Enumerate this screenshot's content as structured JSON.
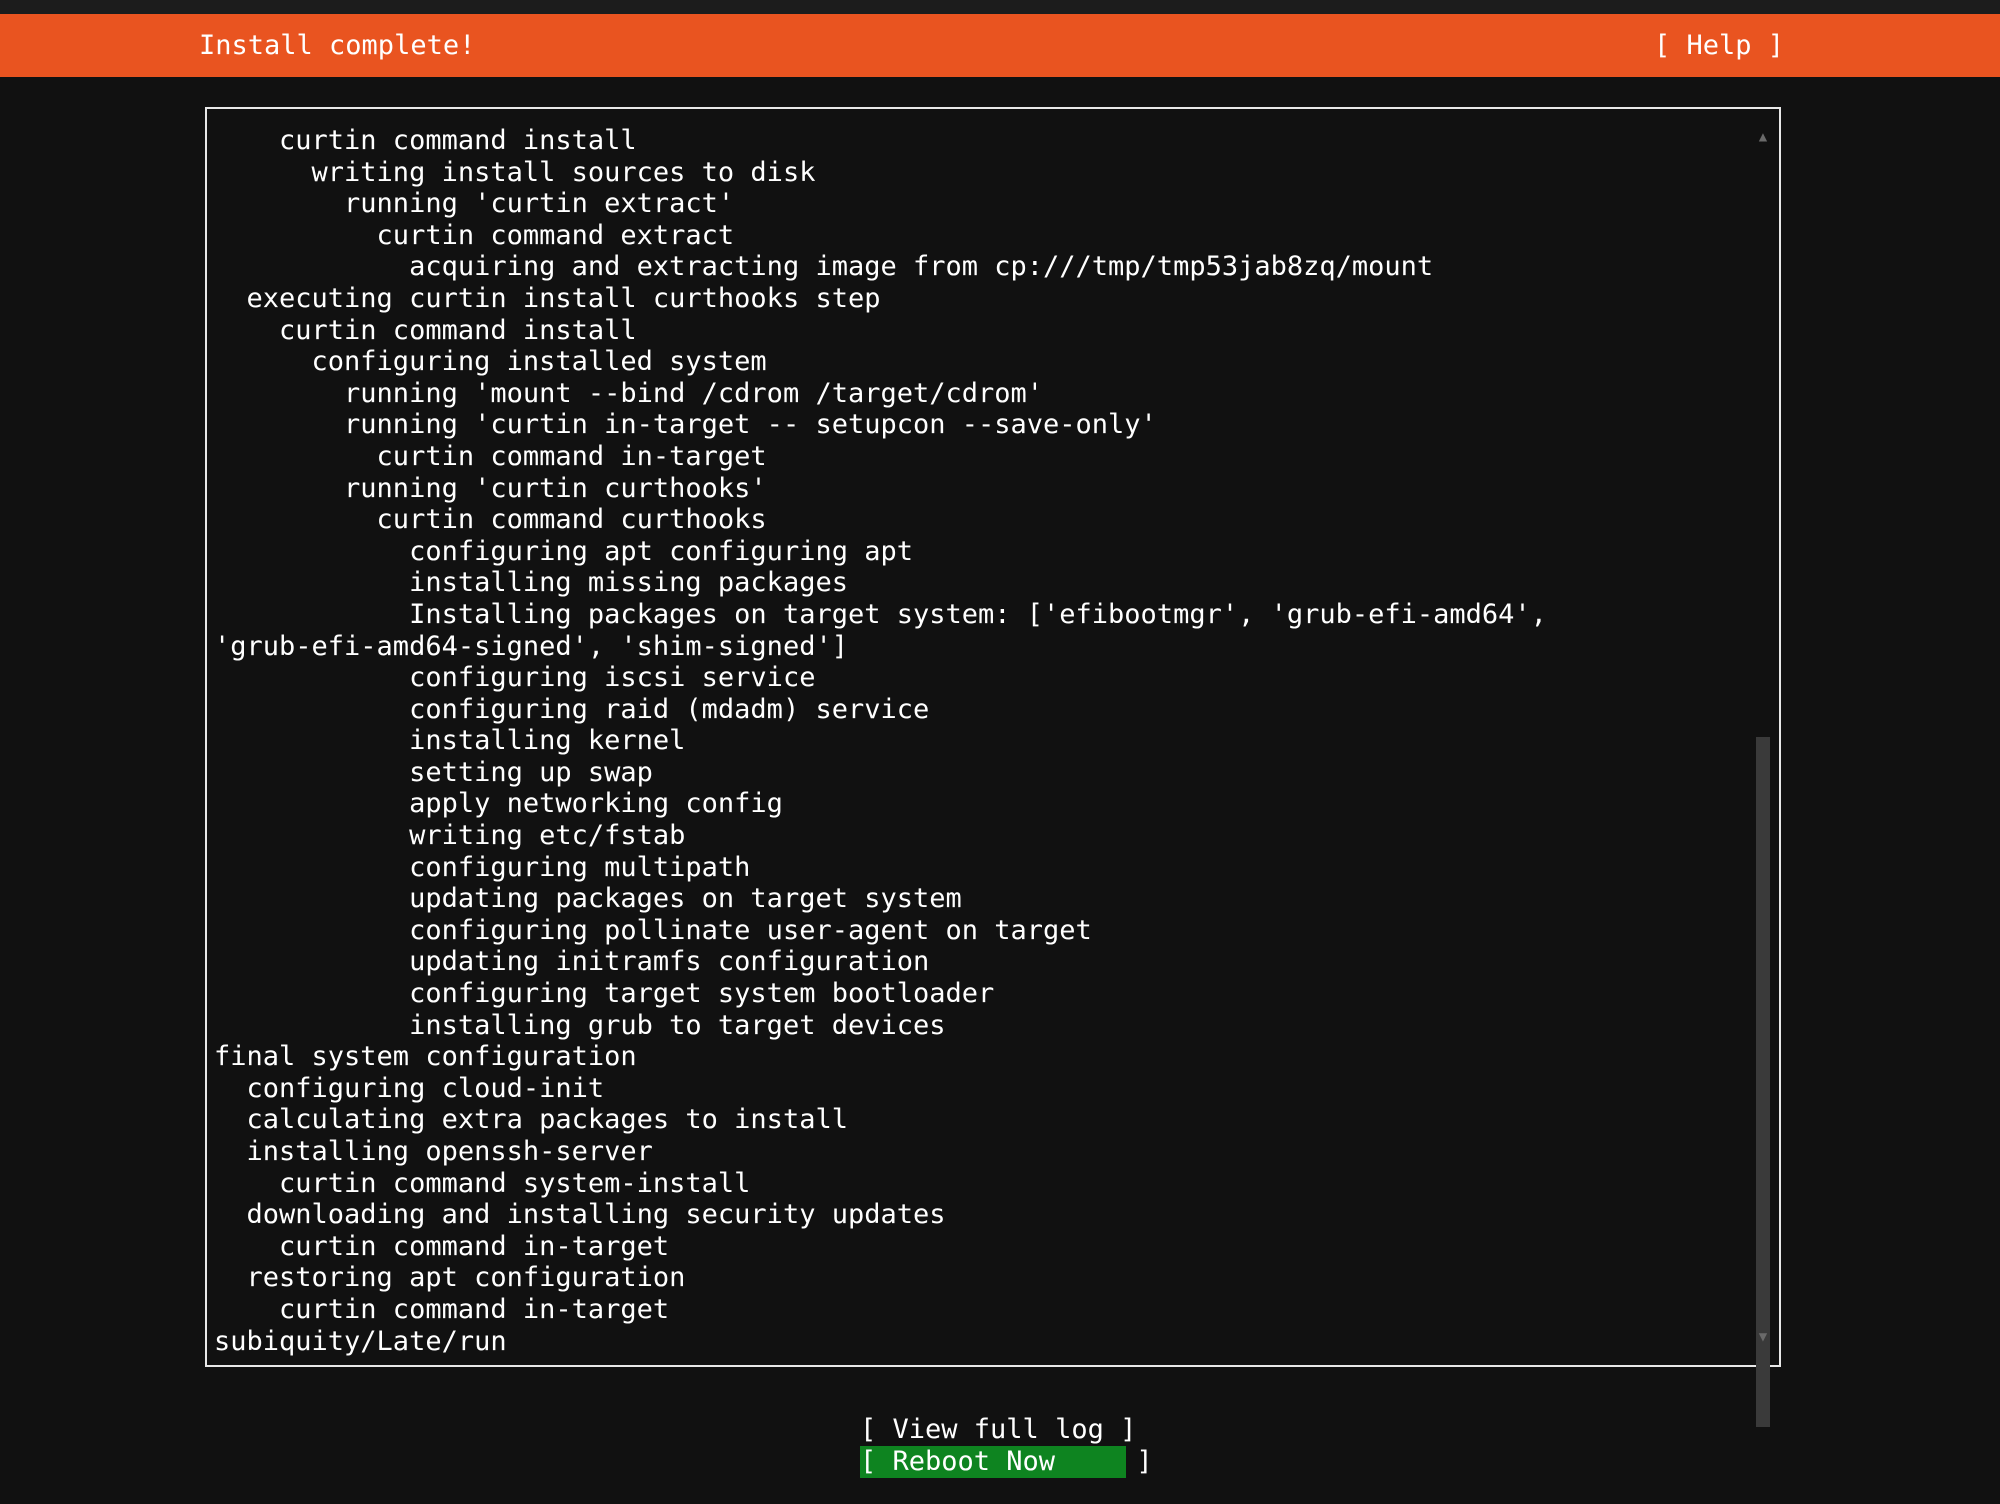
{
  "header": {
    "title": "Install complete!",
    "help_label": "[ Help ]",
    "accent_color": "#e95420"
  },
  "log": {
    "lines": [
      "    curtin command install",
      "      writing install sources to disk",
      "        running 'curtin extract'",
      "          curtin command extract",
      "            acquiring and extracting image from cp:///tmp/tmp53jab8zq/mount",
      "  executing curtin install curthooks step",
      "    curtin command install",
      "      configuring installed system",
      "        running 'mount --bind /cdrom /target/cdrom'",
      "        running 'curtin in-target -- setupcon --save-only'",
      "          curtin command in-target",
      "        running 'curtin curthooks'",
      "          curtin command curthooks",
      "            configuring apt configuring apt",
      "            installing missing packages",
      "            Installing packages on target system: ['efibootmgr', 'grub-efi-amd64',",
      "'grub-efi-amd64-signed', 'shim-signed']",
      "            configuring iscsi service",
      "            configuring raid (mdadm) service",
      "            installing kernel",
      "            setting up swap",
      "            apply networking config",
      "            writing etc/fstab",
      "            configuring multipath",
      "            updating packages on target system",
      "            configuring pollinate user-agent on target",
      "            updating initramfs configuration",
      "            configuring target system bootloader",
      "            installing grub to target devices",
      "final system configuration",
      "  configuring cloud-init",
      "  calculating extra packages to install",
      "  installing openssh-server",
      "    curtin command system-install",
      "  downloading and installing security updates",
      "    curtin command in-target",
      "  restoring apt configuration",
      "    curtin command in-target",
      "subiquity/Late/run"
    ],
    "scroll_up_icon": "▲",
    "scroll_down_icon": "▼"
  },
  "actions": {
    "view_log_label": "[ View full log ]",
    "reboot_label": "[ Reboot Now     ]",
    "reboot_color": "#0e8420"
  }
}
